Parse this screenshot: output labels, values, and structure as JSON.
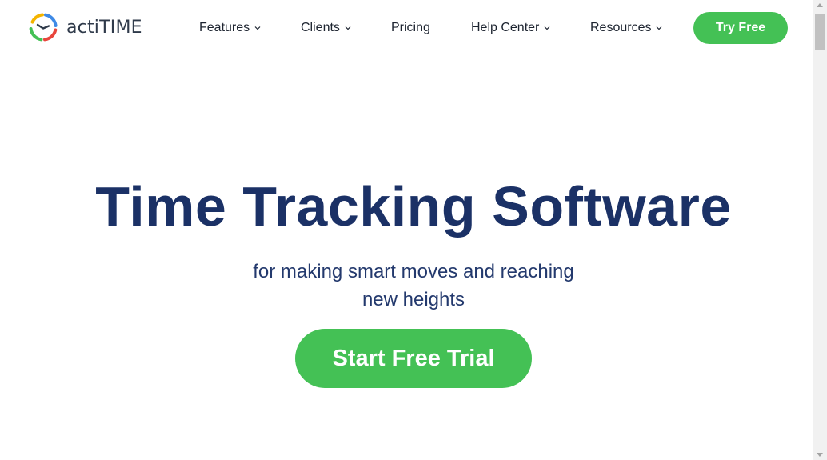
{
  "brand": {
    "name": "actiTIME",
    "logo_icon": "clock-logo-icon",
    "logo_colors": [
      "#f4b400",
      "#44c155",
      "#3f8ae6",
      "#e8453c"
    ]
  },
  "nav": {
    "items": [
      {
        "label": "Features",
        "has_dropdown": true
      },
      {
        "label": "Clients",
        "has_dropdown": true
      },
      {
        "label": "Pricing",
        "has_dropdown": false
      },
      {
        "label": "Help Center",
        "has_dropdown": true
      },
      {
        "label": "Resources",
        "has_dropdown": true
      }
    ],
    "cta_label": "Try Free"
  },
  "hero": {
    "title": "Time Tracking Software",
    "subtitle_line1": "for making smart moves and reaching",
    "subtitle_line2": "new heights",
    "cta_label": "Start Free Trial"
  },
  "colors": {
    "accent_green": "#44c155",
    "title_navy": "#1b3166",
    "text_dark": "#1d2430"
  }
}
